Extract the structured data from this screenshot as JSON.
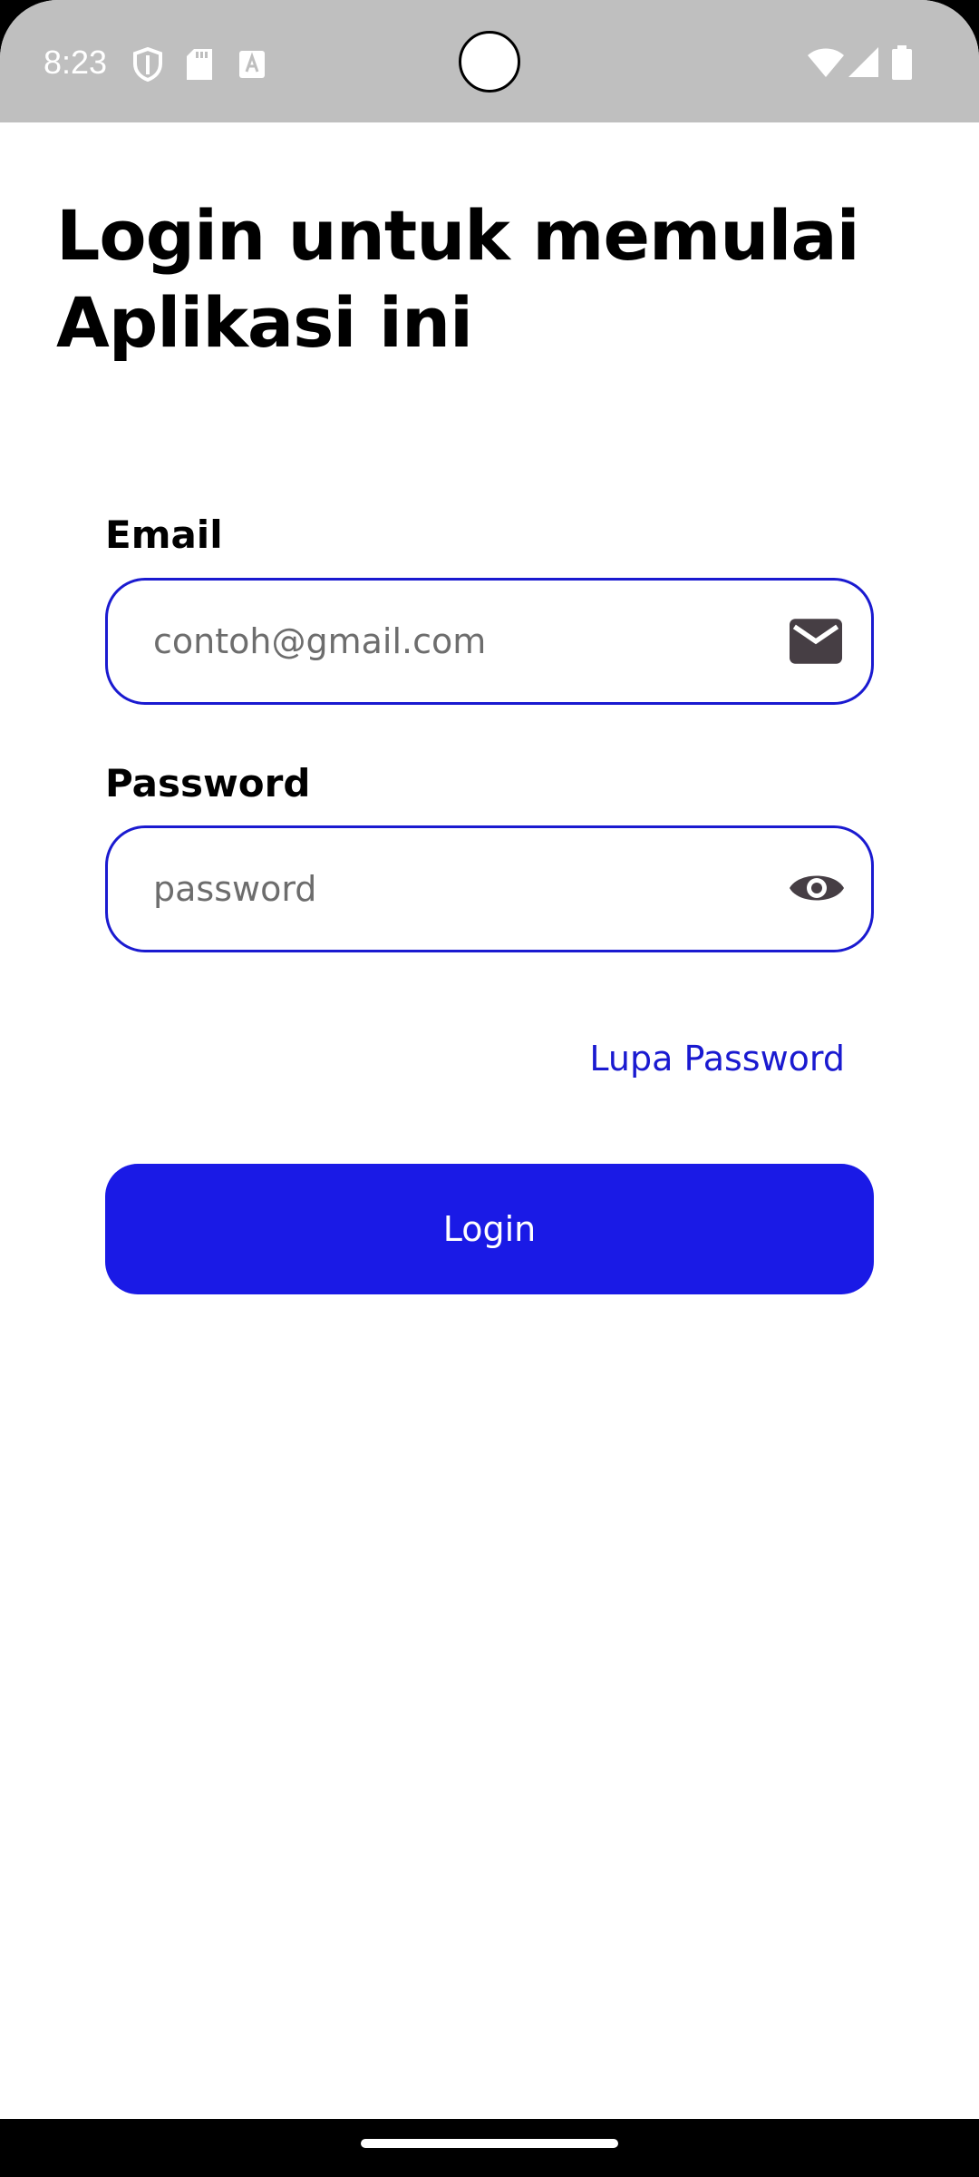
{
  "status_bar": {
    "time": "8:23",
    "left_icons": [
      "shield-icon",
      "sd-card-icon",
      "font-icon"
    ],
    "right_icons": [
      "wifi-icon",
      "cellular-signal-icon",
      "battery-icon"
    ]
  },
  "login": {
    "title": "Login untuk memulai Aplikasi ini",
    "email_label": "Email",
    "email_placeholder": "contoh@gmail.com",
    "email_value": "",
    "password_label": "Password",
    "password_placeholder": "password",
    "password_value": "",
    "forgot_password": "Lupa Password",
    "login_button": "Login"
  },
  "colors": {
    "accent": "#1a1ae6",
    "field_border": "#1a1ad0",
    "status_bar": "#bfbfbf",
    "icon": "#463e44"
  }
}
